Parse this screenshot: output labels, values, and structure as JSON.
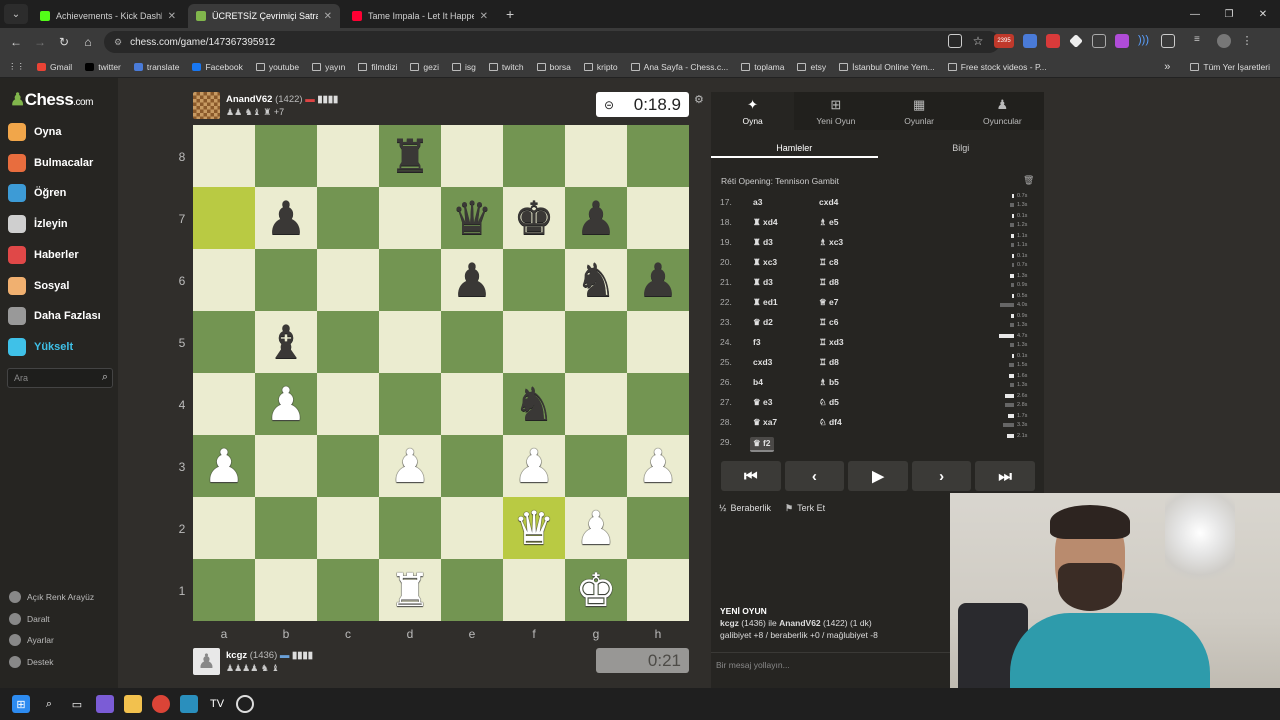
{
  "browser": {
    "tabs": [
      {
        "title": "Achievements - Kick Dashboard",
        "favicon_color": "#53fc18",
        "active": false
      },
      {
        "title": "ÜCRETSİZ Çevrimiçi Satranç",
        "favicon_color": "#81b64c",
        "active": true
      },
      {
        "title": "Tame Impala - Let It Happen",
        "favicon_color": "#ff0033",
        "active": false
      }
    ],
    "new_tab": "+",
    "url": "chess.com/game/147367395912",
    "bookmarks": [
      "Gmail",
      "twitter",
      "translate",
      "Facebook",
      "youtube",
      "yayın",
      "filmdizi",
      "gezi",
      "isg",
      "twitch",
      "borsa",
      "kripto",
      "Ana Sayfa - Chess.c...",
      "toplama",
      "etsy",
      "İstanbul Online Yem...",
      "Free stock videos - P..."
    ],
    "bookmarks_more": "»",
    "all_bookmarks": "Tüm Yer İşaretleri",
    "extension_badge": "2395"
  },
  "sidebar": {
    "logo": "Chess",
    "logo_suffix": ".com",
    "items": [
      {
        "label": "Oyna",
        "color": "#f1a64a"
      },
      {
        "label": "Bulmacalar",
        "color": "#e86d3e"
      },
      {
        "label": "Öğren",
        "color": "#3d9bd6"
      },
      {
        "label": "İzleyin",
        "color": "#cfcfcf"
      },
      {
        "label": "Haberler",
        "color": "#e04848"
      },
      {
        "label": "Sosyal",
        "color": "#f0b070"
      },
      {
        "label": "Daha Fazlası",
        "color": "#999999"
      },
      {
        "label": "Yükselt",
        "color": "#3fc1e8"
      }
    ],
    "search_placeholder": "Ara",
    "bottom": [
      "Açık Renk Arayüz",
      "Daralt",
      "Ayarlar",
      "Destek"
    ]
  },
  "game": {
    "top_player": {
      "name": "AnandV62",
      "rating": "(1422)",
      "captured": "♟♟ ♞♝ ♜ +7"
    },
    "top_clock": "0:18.9",
    "bottom_player": {
      "name": "kcgz",
      "rating": "(1436)",
      "captured": "♟♟♟♟ ♞ ♝"
    },
    "bottom_clock": "0:21",
    "ranks": [
      "8",
      "7",
      "6",
      "5",
      "4",
      "3",
      "2",
      "1"
    ],
    "files": [
      "a",
      "b",
      "c",
      "d",
      "e",
      "f",
      "g",
      "h"
    ],
    "board": [
      [
        "",
        "",
        "",
        "r",
        "",
        "",
        "",
        ""
      ],
      [
        "",
        "p",
        "",
        "",
        "q",
        "k",
        "p",
        ""
      ],
      [
        "",
        "",
        "",
        "",
        "p",
        "",
        "n",
        "p"
      ],
      [
        "",
        "b",
        "",
        "",
        "",
        "",
        "",
        ""
      ],
      [
        "",
        "P",
        "",
        "",
        "",
        "n",
        "",
        ""
      ],
      [
        "P",
        "",
        "",
        "P",
        "",
        "P",
        "",
        "P"
      ],
      [
        "",
        "",
        "",
        "",
        "",
        "Q",
        "P",
        ""
      ],
      [
        "",
        "",
        "",
        "R",
        "",
        "",
        "K",
        ""
      ]
    ],
    "highlight_squares": [
      "a7",
      "f2"
    ]
  },
  "panel": {
    "tabs": [
      {
        "label": "Oyna",
        "icon": "✦"
      },
      {
        "label": "Yeni Oyun",
        "icon": "⊞"
      },
      {
        "label": "Oyunlar",
        "icon": "▦"
      },
      {
        "label": "Oyuncular",
        "icon": "♟"
      }
    ],
    "subtabs": [
      "Hamleler",
      "Bilgi"
    ],
    "opening": "Réti Opening: Tennison Gambit",
    "moves": [
      {
        "num": "17.",
        "white": "a3",
        "black": "cxd4",
        "tw": "0.7s",
        "tb": "1.3s",
        "bw": 0.15,
        "bb": 0.25
      },
      {
        "num": "18.",
        "white": "♜ xd4",
        "black": "♗ e5",
        "tw": "0.1s",
        "tb": "1.2s",
        "bw": 0.05,
        "bb": 0.24
      },
      {
        "num": "19.",
        "white": "♜ d3",
        "black": "♗ xc3",
        "tw": "1.1s",
        "tb": "1.1s",
        "bw": 0.2,
        "bb": 0.2
      },
      {
        "num": "20.",
        "white": "♜ xc3",
        "black": "♖ c8",
        "tw": "0.1s",
        "tb": "0.7s",
        "bw": 0.05,
        "bb": 0.15
      },
      {
        "num": "21.",
        "white": "♜ d3",
        "black": "♖ d8",
        "tw": "1.3s",
        "tb": "0.9s",
        "bw": 0.25,
        "bb": 0.18
      },
      {
        "num": "22.",
        "white": "♜ ed1",
        "black": "♕ e7",
        "tw": "0.5s",
        "tb": "4.0s",
        "bw": 0.1,
        "bb": 0.85
      },
      {
        "num": "23.",
        "white": "♛ d2",
        "black": "♖ c6",
        "tw": "0.9s",
        "tb": "1.3s",
        "bw": 0.18,
        "bb": 0.25
      },
      {
        "num": "24.",
        "white": "f3",
        "black": "♖ xd3",
        "tw": "4.7s",
        "tb": "1.3s",
        "bw": 0.95,
        "bb": 0.25
      },
      {
        "num": "25.",
        "white": "cxd3",
        "black": "♖ d8",
        "tw": "0.1s",
        "tb": "1.5s",
        "bw": 0.05,
        "bb": 0.3
      },
      {
        "num": "26.",
        "white": "b4",
        "black": "♗ b5",
        "tw": "1.6s",
        "tb": "1.3s",
        "bw": 0.3,
        "bb": 0.25
      },
      {
        "num": "27.",
        "white": "♛ e3",
        "black": "♘ d5",
        "tw": "2.6s",
        "tb": "2.8s",
        "bw": 0.55,
        "bb": 0.58
      },
      {
        "num": "28.",
        "white": "♛ xa7",
        "black": "♘ df4",
        "tw": "1.7s",
        "tb": "3.3s",
        "bw": 0.35,
        "bb": 0.68
      },
      {
        "num": "29.",
        "white": "♛ f2",
        "black": "",
        "tw": "2.1s",
        "tb": "",
        "bw": 0.42,
        "bb": 0
      }
    ],
    "controls": [
      "⏮",
      "‹",
      "▶",
      "›",
      "⏭"
    ],
    "draw": "Beraberlik",
    "resign": "Terk Et",
    "new_game_title": "YENİ OYUN",
    "new_game_line1_a": "kcgz",
    "new_game_line1_b": "(1436) ile",
    "new_game_line1_c": "AnandV62",
    "new_game_line1_d": "(1422) (1 dk)",
    "new_game_line2": "galibiyet +8 / beraberlik +0 / mağlubiyet -8",
    "chat_placeholder": "Bir mesaj yollayın..."
  }
}
